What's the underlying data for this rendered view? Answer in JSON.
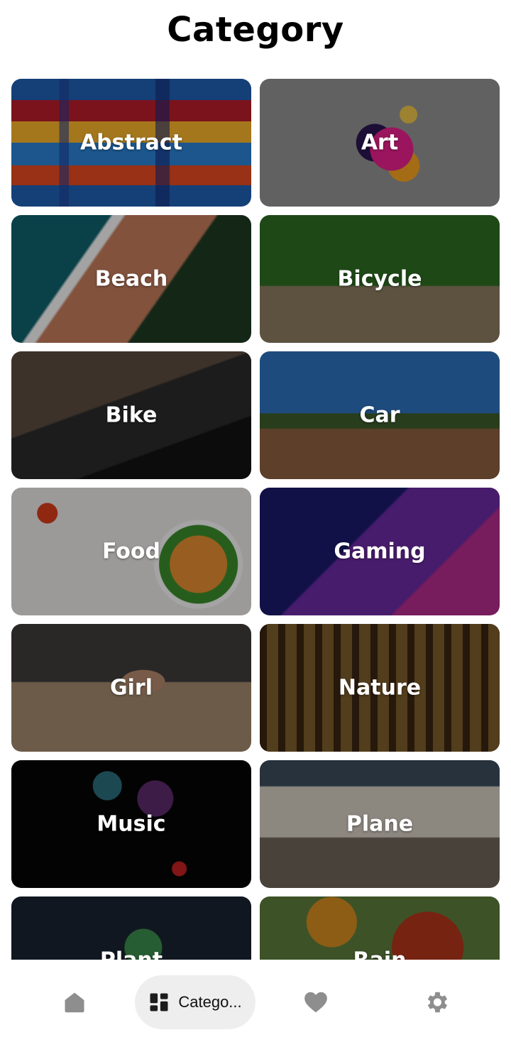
{
  "header": {
    "title": "Category"
  },
  "categories": [
    {
      "label": "Abstract"
    },
    {
      "label": "Art"
    },
    {
      "label": "Beach"
    },
    {
      "label": "Bicycle"
    },
    {
      "label": "Bike"
    },
    {
      "label": "Car"
    },
    {
      "label": "Food"
    },
    {
      "label": "Gaming"
    },
    {
      "label": "Girl"
    },
    {
      "label": "Nature"
    },
    {
      "label": "Music"
    },
    {
      "label": "Plane"
    },
    {
      "label": "Plant"
    },
    {
      "label": "Rain"
    }
  ],
  "bottom_nav": {
    "items": [
      {
        "icon": "home-icon",
        "label": ""
      },
      {
        "icon": "category-grid-icon",
        "label": "Catego..."
      },
      {
        "icon": "heart-icon",
        "label": ""
      },
      {
        "icon": "gear-icon",
        "label": ""
      }
    ],
    "active_index": 1
  },
  "colors": {
    "icon_inactive": "#8e8e8e",
    "icon_active": "#1c1c1c",
    "active_pill": "#eeeeee",
    "background": "#ffffff"
  }
}
